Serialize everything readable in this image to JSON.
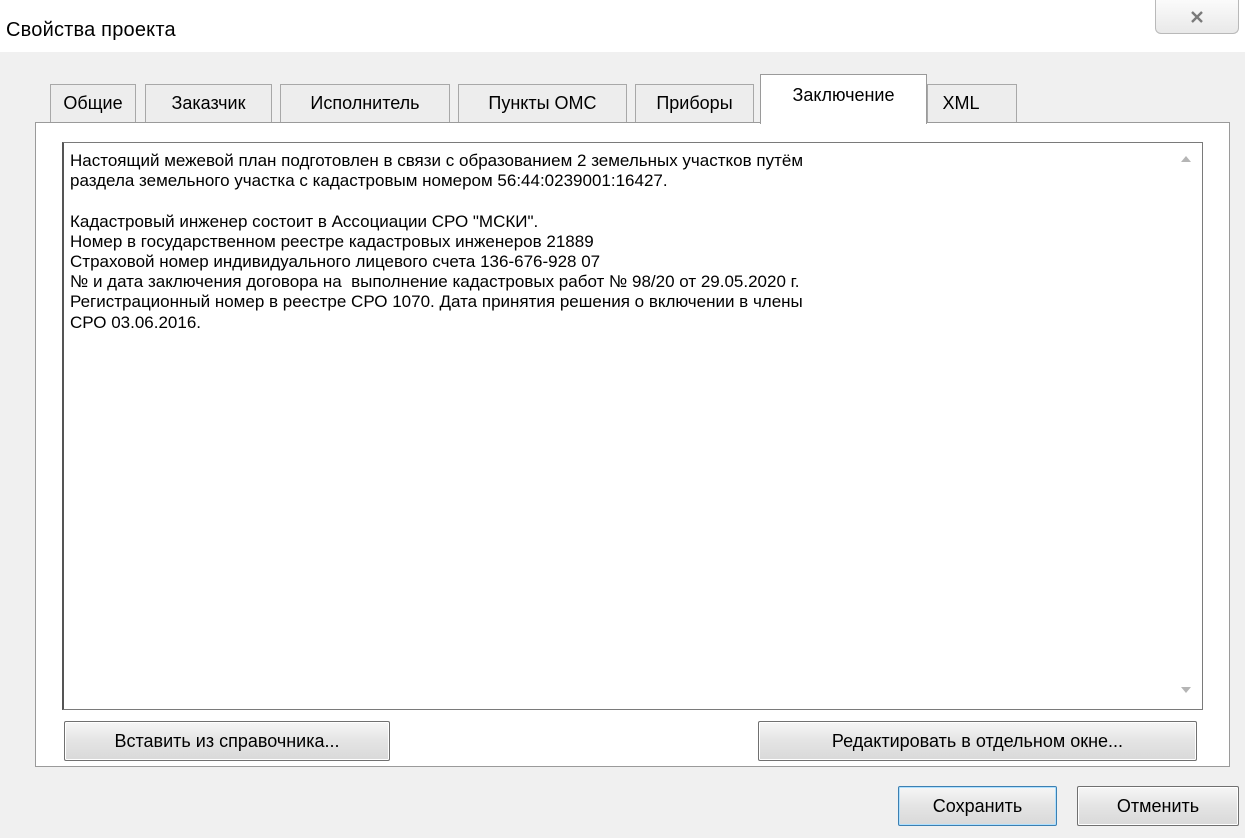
{
  "window": {
    "title": "Свойства проекта",
    "close_icon": "close-icon"
  },
  "tabs": [
    {
      "label": "Общие"
    },
    {
      "label": "Заказчик"
    },
    {
      "label": "Исполнитель"
    },
    {
      "label": "Пункты ОМС"
    },
    {
      "label": "Приборы"
    },
    {
      "label": "Заключение",
      "active": true
    },
    {
      "label": "XML"
    }
  ],
  "conclusion": {
    "text": "Настоящий межевой план подготовлен в связи с образованием 2 земельных участков путём\nраздела земельного участка с кадастровым номером 56:44:0239001:16427.\n\nКадастровый инженер состоит в Ассоциации СРО \"МСКИ\".\nНомер в государственном реестре кадастровых инженеров 21889\nСтраховой номер индивидуального лицевого счета 136-676-928 07\n№ и дата заключения договора на  выполнение кадастровых работ № 98/20 от 29.05.2020 г.\nРегистрационный номер в реестре СРО 1070. Дата принятия решения о включении в члены\nСРО 03.06.2016.",
    "insert_button": "Вставить из справочника...",
    "edit_button": "Редактировать в отдельном окне..."
  },
  "footer": {
    "save_button": "Сохранить",
    "cancel_button": "Отменить"
  },
  "icons": {
    "close": "close-icon",
    "scroll_up": "scroll-up-arrow-icon",
    "scroll_down": "scroll-down-arrow-icon"
  },
  "colors": {
    "window_bg": "#f0f0f0",
    "panel_bg": "#ffffff",
    "default_button_border": "#3c7fb1"
  }
}
